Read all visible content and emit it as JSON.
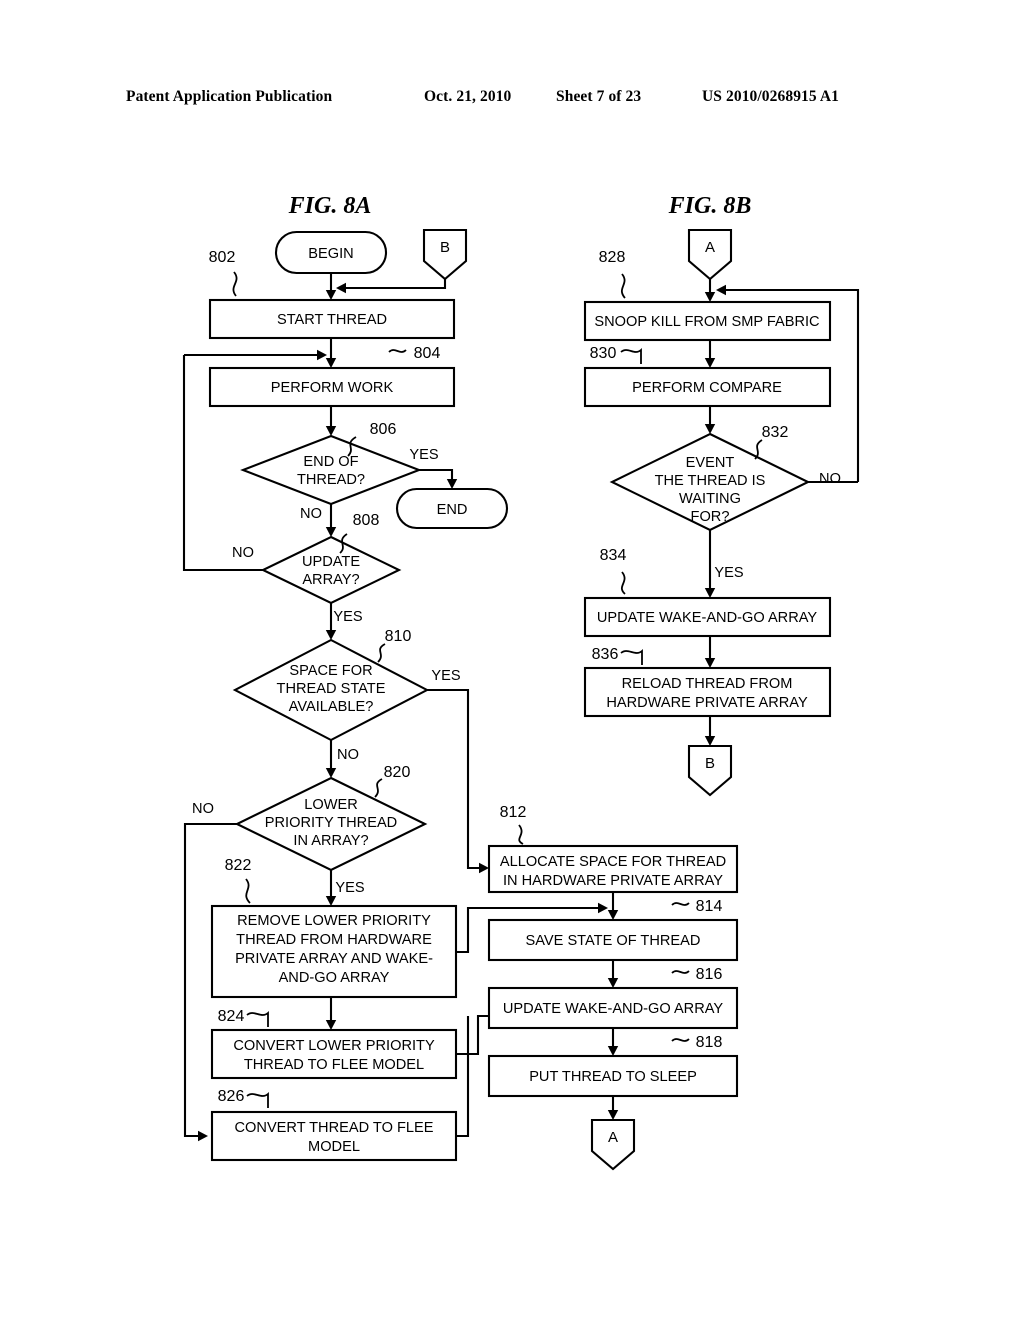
{
  "header": {
    "publication": "Patent Application Publication",
    "date": "Oct. 21, 2010",
    "sheet": "Sheet 7 of 23",
    "number": "US 2010/0268915 A1"
  },
  "figures": {
    "a": {
      "label": "FIG. 8A"
    },
    "b": {
      "label": "FIG. 8B"
    }
  },
  "fig8a": {
    "begin": "BEGIN",
    "end": "END",
    "conn_b_in": "B",
    "conn_a_out": "A",
    "n802": "802",
    "n804": "804",
    "n806": "806",
    "n808": "808",
    "n810": "810",
    "n812": "812",
    "n814": "814",
    "n816": "816",
    "n818": "818",
    "n820": "820",
    "n822": "822",
    "n824": "824",
    "n826": "826",
    "b802": "START THREAD",
    "b804": "PERFORM WORK",
    "d806_l1": "END OF",
    "d806_l2": "THREAD?",
    "d808_l1": "UPDATE",
    "d808_l2": "ARRAY?",
    "d810_l1": "SPACE FOR",
    "d810_l2": "THREAD STATE",
    "d810_l3": "AVAILABLE?",
    "d820_l1": "LOWER",
    "d820_l2": "PRIORITY THREAD",
    "d820_l3": "IN ARRAY?",
    "b812_l1": "ALLOCATE SPACE FOR  THREAD",
    "b812_l2": "IN HARDWARE PRIVATE ARRAY",
    "b814": "SAVE STATE OF THREAD",
    "b816": "UPDATE WAKE-AND-GO ARRAY",
    "b818": "PUT THREAD TO SLEEP",
    "b822_l1": "REMOVE LOWER PRIORITY",
    "b822_l2": "THREAD FROM HARDWARE",
    "b822_l3": "PRIVATE ARRAY AND WAKE-",
    "b822_l4": "AND-GO ARRAY",
    "b824_l1": "CONVERT LOWER PRIORITY",
    "b824_l2": "THREAD TO FLEE MODEL",
    "b826_l1": "CONVERT THREAD TO FLEE",
    "b826_l2": "MODEL",
    "yes806": "YES",
    "no806": "NO",
    "no808": "NO",
    "yes808": "YES",
    "yes810": "YES",
    "no810": "NO",
    "no820": "NO",
    "yes820": "YES"
  },
  "fig8b": {
    "conn_a_in": "A",
    "conn_b_out": "B",
    "n828": "828",
    "n830": "830",
    "n832": "832",
    "n834": "834",
    "n836": "836",
    "b828": "SNOOP KILL FROM SMP FABRIC",
    "b830": "PERFORM COMPARE",
    "d832_l1": "EVENT",
    "d832_l2": "THE THREAD IS",
    "d832_l3": "WAITING",
    "d832_l4": "FOR?",
    "b834": "UPDATE WAKE-AND-GO ARRAY",
    "b836_l1": "RELOAD THREAD FROM",
    "b836_l2": "HARDWARE PRIVATE ARRAY",
    "no832": "NO",
    "yes832": "YES"
  }
}
